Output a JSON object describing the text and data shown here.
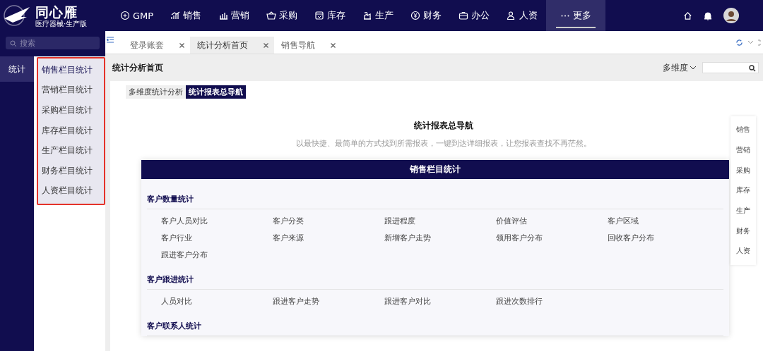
{
  "brand": {
    "name": "同心雁",
    "tagline": "医疗器械·生产版"
  },
  "top_nav": [
    {
      "label": "GMP",
      "selected": false
    },
    {
      "label": "销售",
      "selected": false
    },
    {
      "label": "营销",
      "selected": false
    },
    {
      "label": "采购",
      "selected": false
    },
    {
      "label": "库存",
      "selected": false
    },
    {
      "label": "生产",
      "selected": false
    },
    {
      "label": "财务",
      "selected": false
    },
    {
      "label": "办公",
      "selected": false
    },
    {
      "label": "人资",
      "selected": false
    },
    {
      "label": "更多",
      "selected": true
    }
  ],
  "sidebar": {
    "search_placeholder": "搜索",
    "rail": [
      {
        "label": "统计",
        "selected": true
      }
    ],
    "items": [
      {
        "label": "销售栏目统计",
        "selected": true
      },
      {
        "label": "营销栏目统计",
        "selected": false
      },
      {
        "label": "采购栏目统计",
        "selected": false
      },
      {
        "label": "库存栏目统计",
        "selected": false
      },
      {
        "label": "生产栏目统计",
        "selected": false
      },
      {
        "label": "财务栏目统计",
        "selected": false
      },
      {
        "label": "人资栏目统计",
        "selected": false
      }
    ]
  },
  "tabs": [
    {
      "label": "登录账套",
      "selected": false
    },
    {
      "label": "统计分析首页",
      "selected": true
    },
    {
      "label": "销售导航",
      "selected": false
    }
  ],
  "page": {
    "title": "统计分析首页",
    "dimension": "多维度",
    "subtabs": [
      {
        "label": "多维度统计分析",
        "selected": false
      },
      {
        "label": "统计报表总导航",
        "selected": true
      }
    ],
    "heading": "统计报表总导航",
    "subtitle": "以最快捷、最简单的方式找到所需报表，一键到达详细报表，让您报表查找不再茫然。",
    "card_title": "销售栏目统计",
    "sections": [
      {
        "title": "客户数量统计",
        "links": [
          "客户人员对比",
          "客户分类",
          "跟进程度",
          "价值评估",
          "客户区域",
          "客户行业",
          "客户来源",
          "新增客户走势",
          "领用客户分布",
          "回收客户分布",
          "跟进客户分布"
        ]
      },
      {
        "title": "客户跟进统计",
        "links": [
          "人员对比",
          "跟进客户走势",
          "跟进客户对比",
          "跟进次数排行"
        ]
      },
      {
        "title": "客户联系人统计"
      }
    ],
    "side_nav": [
      "销售",
      "营销",
      "采购",
      "库存",
      "生产",
      "财务",
      "人资"
    ]
  }
}
